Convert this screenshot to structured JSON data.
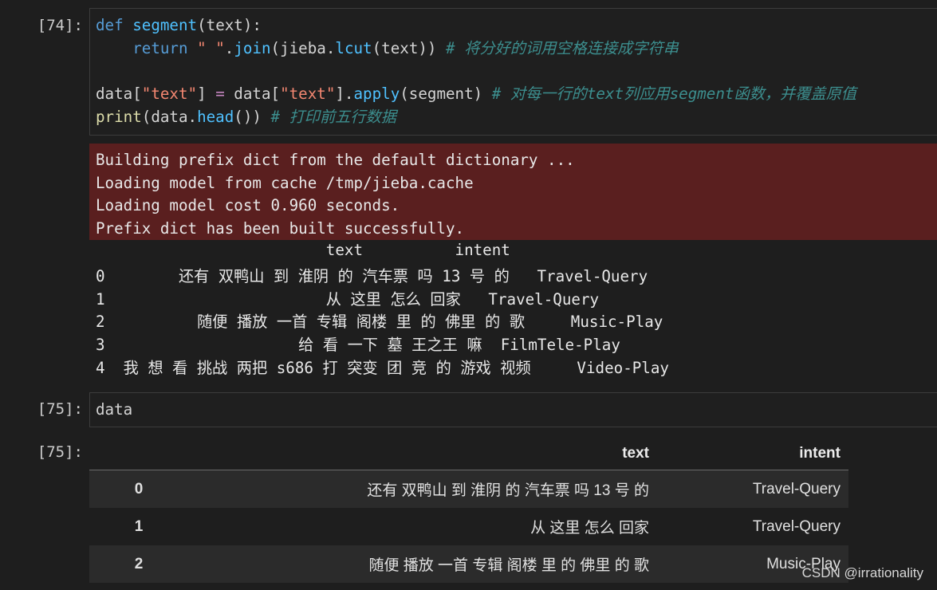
{
  "cells": {
    "c74": {
      "prompt": "[74]:",
      "code_lines": [
        "def segment(text):",
        "    return \" \".join(jieba.lcut(text)) # 将分好的词用空格连接成字符串",
        "",
        "data[\"text\"] = data[\"text\"].apply(segment) # 对每一行的text列应用segment函数，并覆盖原值",
        "print(data.head()) # 打印前五行数据"
      ],
      "stderr": [
        "Building prefix dict from the default dictionary ...",
        "Loading model from cache /tmp/jieba.cache",
        "Loading model cost 0.960 seconds.",
        "Prefix dict has been built successfully."
      ],
      "stdout": [
        "                         text          intent",
        "0        还有 双鸭山 到 淮阴 的 汽车票 吗 13 号 的   Travel-Query",
        "1                        从 这里 怎么 回家   Travel-Query",
        "2          随便 播放 一首 专辑 阁楼 里 的 佛里 的 歌     Music-Play",
        "3                     给 看 一下 墓 王之王 嘛  FilmTele-Play",
        "4  我 想 看 挑战 两把 s686 打 突变 团 竞 的 游戏 视频     Video-Play"
      ]
    },
    "c75": {
      "prompt": "[75]:",
      "code": "data",
      "out_prompt": "[75]:",
      "table": {
        "columns": [
          "",
          "text",
          "intent"
        ],
        "rows": [
          {
            "index": "0",
            "text": "还有 双鸭山 到 淮阴 的 汽车票 吗 13 号 的",
            "intent": "Travel-Query"
          },
          {
            "index": "1",
            "text": "从 这里 怎么 回家",
            "intent": "Travel-Query"
          },
          {
            "index": "2",
            "text": "随便 播放 一首 专辑 阁楼 里 的 佛里 的 歌",
            "intent": "Music-Play"
          }
        ]
      }
    }
  },
  "watermark": "CSDN @irrationality",
  "colors": {
    "background": "#1e1e1e",
    "stderr_bg": "#5a1f1f",
    "keyword": "#569cd6",
    "string": "#f48771",
    "comment": "#3c8e8e"
  }
}
